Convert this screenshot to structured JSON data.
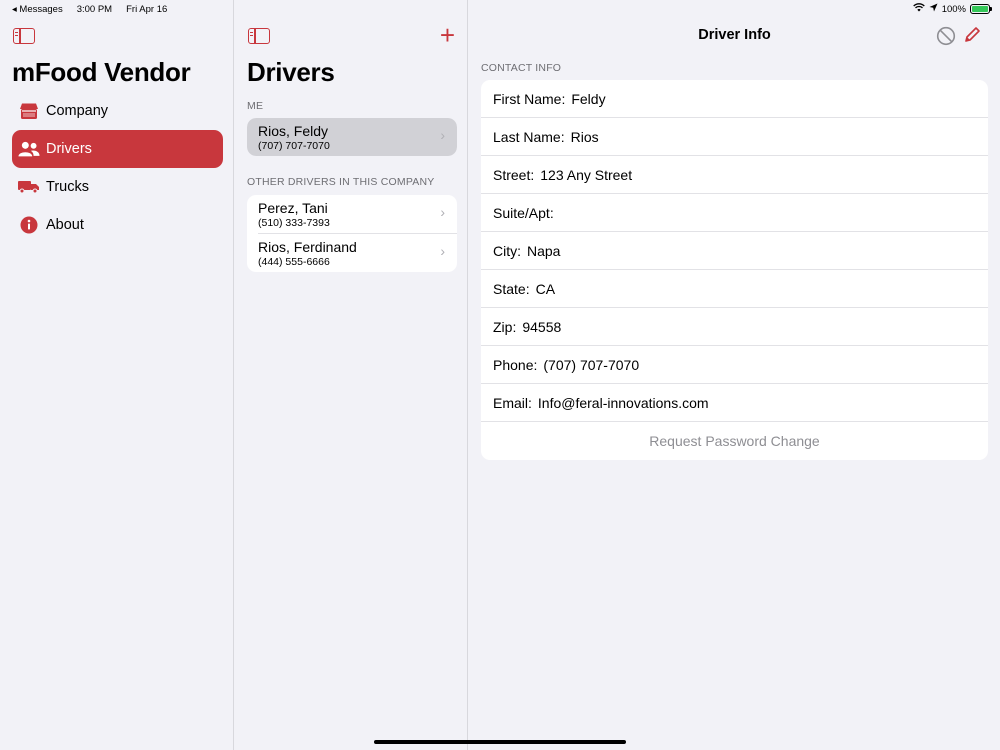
{
  "status_bar": {
    "back_app": "◂ Messages",
    "time": "3:00 PM",
    "date": "Fri Apr 16",
    "battery": "100%"
  },
  "sidebar": {
    "title": "mFood Vendor",
    "items": [
      {
        "label": "Company",
        "icon": "storefront-icon"
      },
      {
        "label": "Drivers",
        "icon": "people-icon",
        "selected": true
      },
      {
        "label": "Trucks",
        "icon": "truck-icon"
      },
      {
        "label": "About",
        "icon": "info-icon"
      }
    ]
  },
  "list": {
    "title": "Drivers",
    "me_header": "ME",
    "me": {
      "name": "Rios, Feldy",
      "phone": "(707) 707-7070"
    },
    "others_header": "OTHER DRIVERS IN THIS COMPANY",
    "others": [
      {
        "name": "Perez, Tani",
        "phone": "(510) 333-7393"
      },
      {
        "name": "Rios, Ferdinand",
        "phone": "(444) 555-6666"
      }
    ]
  },
  "detail": {
    "title": "Driver Info",
    "section": "CONTACT INFO",
    "fields": [
      {
        "label": "First Name:",
        "value": "Feldy"
      },
      {
        "label": "Last Name:",
        "value": "Rios"
      },
      {
        "label": "Street:",
        "value": "123 Any Street"
      },
      {
        "label": "Suite/Apt:",
        "value": ""
      },
      {
        "label": "City:",
        "value": "Napa"
      },
      {
        "label": "State:",
        "value": "CA"
      },
      {
        "label": "Zip:",
        "value": "94558"
      },
      {
        "label": "Phone:",
        "value": "(707) 707-7070"
      },
      {
        "label": "Email:",
        "value": "Info@feral-innovations.com"
      }
    ],
    "password_button": "Request Password Change"
  },
  "colors": {
    "accent": "#c8373d",
    "background": "#f2f2f7"
  }
}
